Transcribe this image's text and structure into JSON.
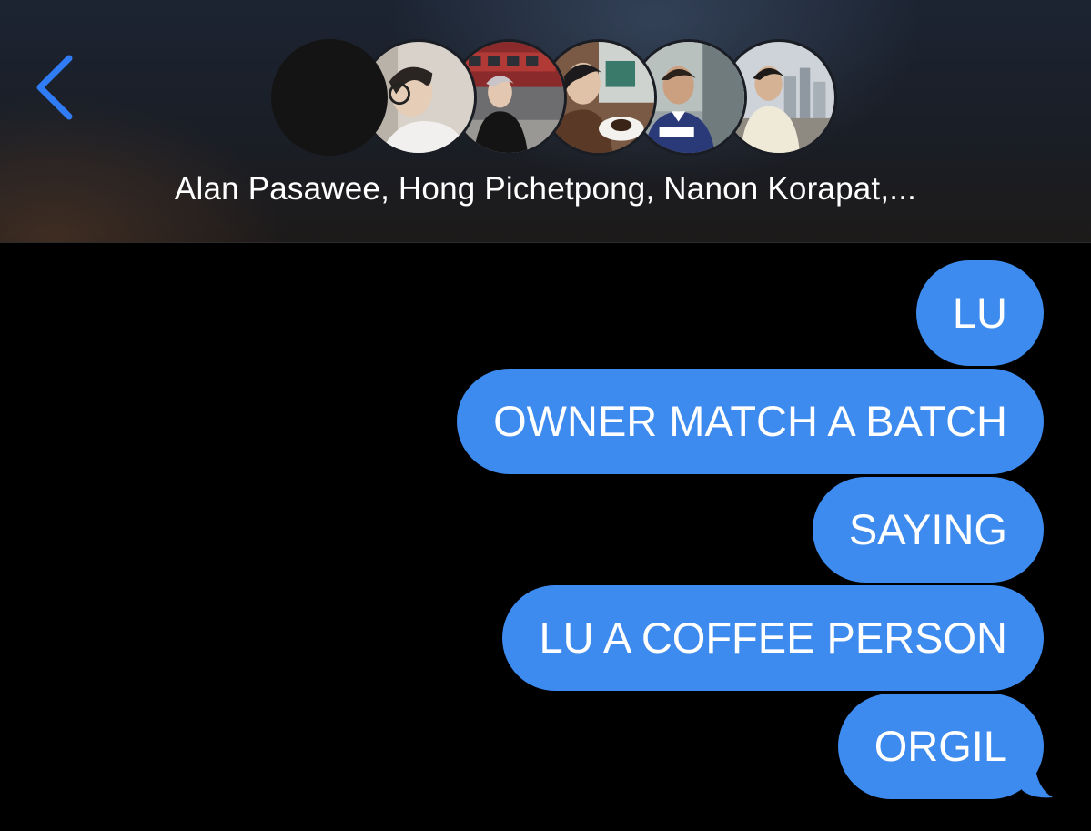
{
  "header": {
    "back_icon": "chevron-left-icon",
    "group_name": "Alan Pasawee, Hong Pichetpong, Nanon Korapat,...",
    "avatars": [
      {
        "name": "avatar-placeholder",
        "color": "#141414"
      },
      {
        "name": "avatar-photo-1",
        "color": "#d9d3cc"
      },
      {
        "name": "avatar-photo-2",
        "color": "#4a4a4e"
      },
      {
        "name": "avatar-photo-3",
        "color": "#6b4a35"
      },
      {
        "name": "avatar-photo-4",
        "color": "#3d4a66"
      },
      {
        "name": "avatar-photo-5",
        "color": "#c8c2b4"
      }
    ]
  },
  "messages": [
    {
      "text": "LU",
      "sender": "me"
    },
    {
      "text": "OWNER MATCH A BATCH",
      "sender": "me"
    },
    {
      "text": "SAYING",
      "sender": "me"
    },
    {
      "text": "LU A COFFEE PERSON",
      "sender": "me"
    },
    {
      "text": "ORGIL",
      "sender": "me"
    }
  ],
  "colors": {
    "bubble_blue": "#3d8bef",
    "accent_blue": "#2f7cf6",
    "background": "#000000"
  }
}
